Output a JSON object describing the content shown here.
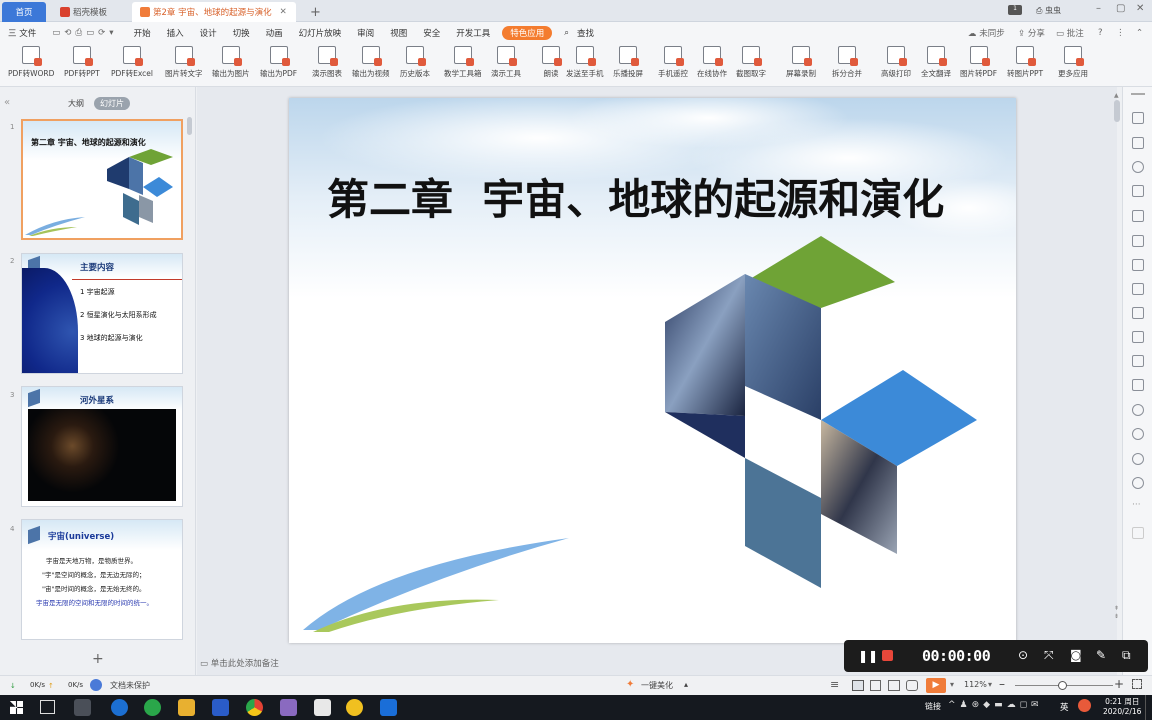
{
  "tabs": [
    {
      "label": "首页"
    },
    {
      "label": "稻壳模板"
    },
    {
      "label": "第2章 宇宙、地球的起源与演化"
    }
  ],
  "window_user": "虫虫",
  "menu": [
    "三 文件",
    "开始",
    "插入",
    "设计",
    "切换",
    "动画",
    "幻灯片放映",
    "审阅",
    "视图",
    "安全",
    "开发工具",
    "特色应用",
    "查找"
  ],
  "menu_right": [
    "未同步",
    "分享",
    "批注"
  ],
  "toolbar": [
    "PDF转WORD",
    "PDF转PPT",
    "PDF转Excel",
    "图片转文字",
    "输出为图片",
    "输出为PDF",
    "演示图表",
    "输出为视频",
    "历史版本",
    "教学工具箱",
    "演示工具",
    "朗读",
    "发送至手机",
    "乐播投屏",
    "手机遥控",
    "在线协作",
    "截图取字",
    "屏幕录制",
    "拆分合并",
    "高级打印",
    "全文翻译",
    "图片转PDF",
    "转图片PPT",
    "更多应用"
  ],
  "panel_tabs": {
    "outline": "大纲",
    "slides": "幻灯片"
  },
  "thumbs": {
    "t1": "第二章 宇宙、地球的起源和演化",
    "t2_title": "主要内容",
    "t2_items": [
      "1 宇宙起源",
      "2 恒星演化与太阳系形成",
      "3 地球的起源与演化"
    ],
    "t3_title": "河外星系",
    "t4_title": "宇宙(universe)",
    "t4_lines": [
      "宇宙是天地万物，是物质世界。",
      "\"宇\"是空间的概念，是无边无际的；",
      "\"宙\"是时间的概念，是无始无终的。",
      "宇宙是无限的空间和无限的时间的统一。"
    ]
  },
  "slide_title": "第二章  宇宙、地球的起源和演化",
  "notes_placeholder": "单击此处添加备注",
  "status": {
    "net_down": "0K/s",
    "net_up": "0K/s",
    "protect": "文档未保护",
    "beautify": "一键美化",
    "zoom": "112%"
  },
  "recorder_time": "00:00:00",
  "clock": {
    "time": "0:21 周日",
    "date": "2020/2/16"
  },
  "tray_lang": "英",
  "tray_link": "链接"
}
